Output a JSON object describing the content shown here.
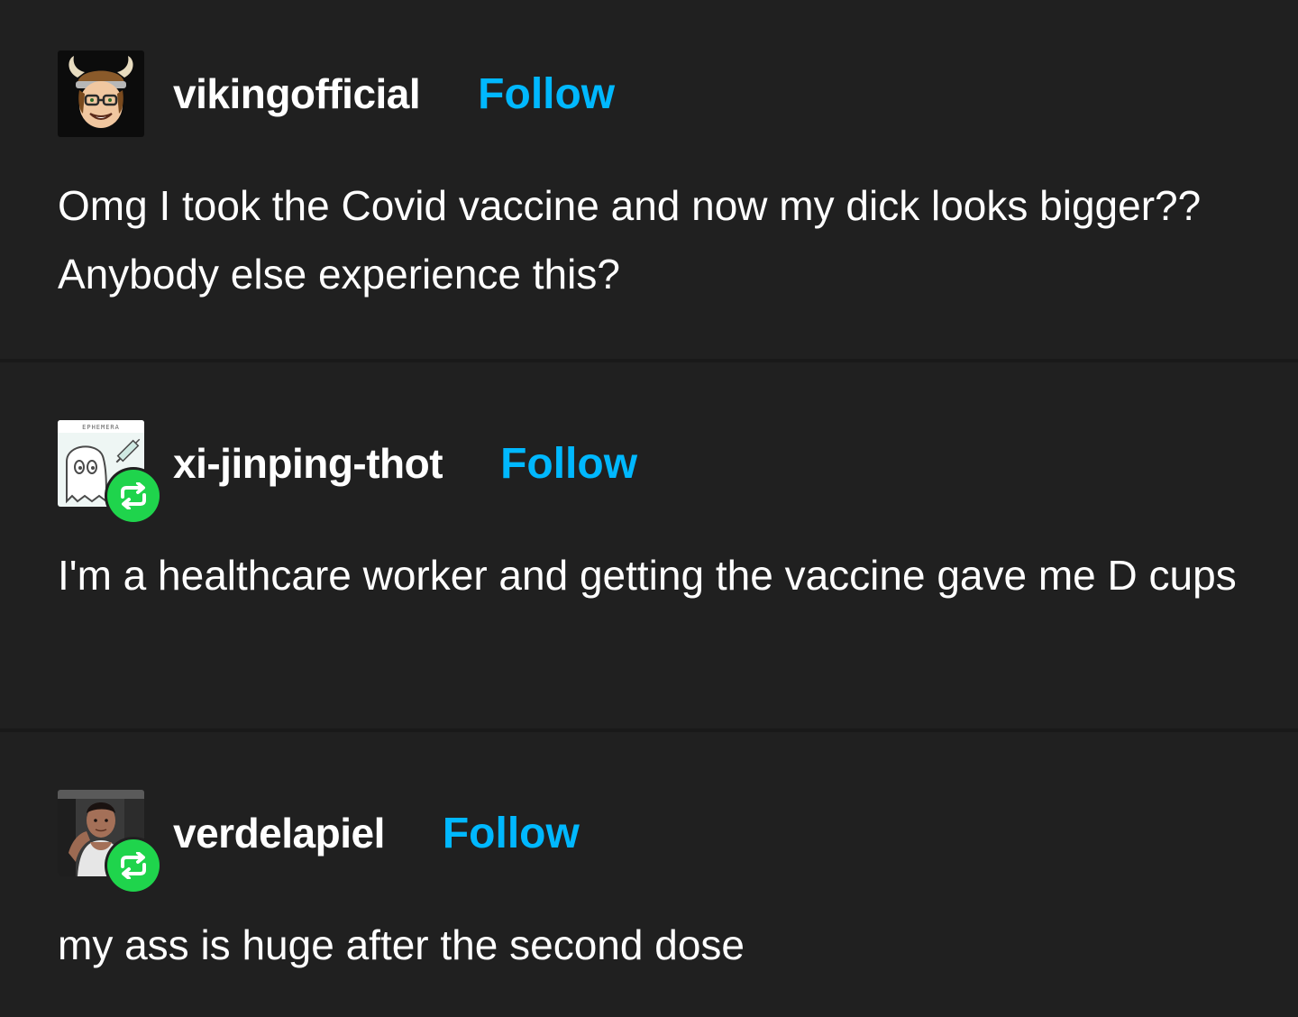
{
  "posts": [
    {
      "username": "vikingofficial",
      "follow_label": "Follow",
      "avatar": "viking-cartoon-avatar",
      "reblogged": false,
      "text": "Omg I took the Covid vaccine and now my dick looks bigger?? Anybody else experience this?"
    },
    {
      "username": "xi-jinping-thot",
      "follow_label": "Follow",
      "avatar": "ghost-drawing-avatar",
      "avatar_caption": "EPHEMERA",
      "reblogged": true,
      "text": "I'm a healthcare worker and getting the vaccine gave me D cups"
    },
    {
      "username": "verdelapiel",
      "follow_label": "Follow",
      "avatar": "person-photo-avatar",
      "reblogged": true,
      "text": "my ass is huge after the second dose"
    }
  ],
  "colors": {
    "background": "#202020",
    "divider": "#191919",
    "text": "#ffffff",
    "follow": "#00b8ff",
    "reblog_badge": "#1fd44c"
  },
  "icons": {
    "reblog": "reblog-icon"
  }
}
